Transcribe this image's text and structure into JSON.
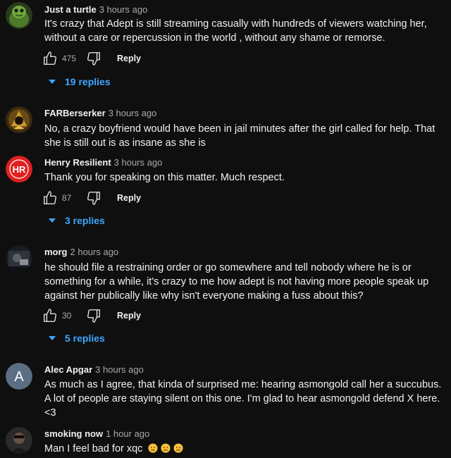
{
  "comments": [
    {
      "author": "Just a turtle",
      "time": "3 hours ago",
      "text": "It's crazy that Adept is still streaming casually with hundreds of viewers watching her, without a care or repercussion in the world , without any shame or remorse.",
      "likes": "475",
      "reply_label": "Reply",
      "replies_label": "19 replies"
    },
    {
      "author": "FARBerserker",
      "time": "3 hours ago",
      "text": "No, a crazy boyfriend would have been in jail minutes after the girl called for help. That she is still out is as insane as she is"
    },
    {
      "author": "Henry Resilient",
      "time": "3 hours ago",
      "text": "Thank you for speaking on this matter. Much respect.",
      "likes": "87",
      "reply_label": "Reply",
      "replies_label": "3 replies",
      "avatar_text": "HR"
    },
    {
      "author": "morg",
      "time": "2 hours ago",
      "text": "he should file a restraining order or go somewhere and tell nobody where he is or something for a while, it's crazy to me how adept is not having more people speak up against her publically like why isn't everyone making a fuss about this?",
      "likes": "30",
      "reply_label": "Reply",
      "replies_label": "5 replies"
    },
    {
      "author": "Alec Apgar",
      "time": "3 hours ago",
      "text": "As much as I agree, that kinda of surprised me: hearing asmongold call her a succubus. A lot of people are staying silent on this one. I'm glad to hear asmongold defend X here. <3",
      "avatar_text": "A"
    },
    {
      "author": "smoking now",
      "time": "1 hour ago",
      "text": "Man I feel bad for xqc",
      "emoji": [
        "worried-face",
        "worried-face",
        "worried-face"
      ]
    }
  ],
  "colors": {
    "background": "#0f0f0f",
    "text": "#f1f1f1",
    "muted": "#aaaaaa",
    "link": "#3ea6ff",
    "henry_avatar": "#e02020",
    "alec_avatar": "#5a6e84"
  }
}
